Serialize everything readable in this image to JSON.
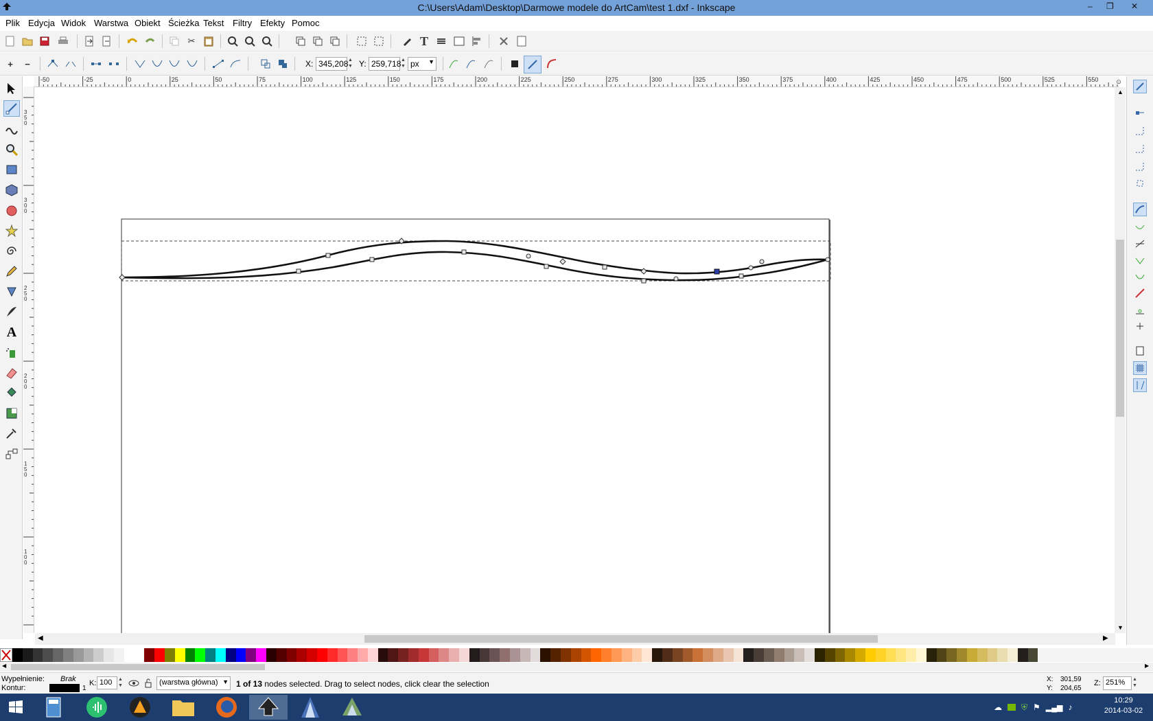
{
  "window": {
    "title": "C:\\Users\\Adam\\Desktop\\Darmowe modele do ArtCam\\test 1.dxf - Inkscape",
    "controls": [
      "–",
      "❐",
      "✕"
    ]
  },
  "menu": [
    "Plik",
    "Edycja",
    "Widok",
    "Warstwa",
    "Obiekt",
    "Ścieżka",
    "Tekst",
    "Filtry",
    "Efekty",
    "Pomoc"
  ],
  "node_toolbar": {
    "x_label": "X:",
    "x_value": "345,208",
    "y_label": "Y:",
    "y_value": "259,718",
    "unit": "px"
  },
  "rulers": {
    "horizontal_labels": [
      "-50",
      "-25",
      "0",
      "25",
      "50",
      "75",
      "100",
      "125",
      "150",
      "175",
      "200",
      "225",
      "250",
      "275",
      "300",
      "325",
      "350",
      "375",
      "400",
      "425",
      "450",
      "475",
      "500",
      "525",
      "550"
    ],
    "vertical_labels": [
      "3 5 0",
      "3 0 0",
      "2 5 0",
      "2 0 0",
      "1 5 0",
      "1 0 0"
    ],
    "corner_icon": "zoom-fit-icon"
  },
  "tools": [
    "selector-icon",
    "node-tool-icon",
    "tweak-icon",
    "zoom-icon",
    "rectangle-icon",
    "3d-box-icon",
    "ellipse-icon",
    "star-icon",
    "spiral-icon",
    "pencil-icon",
    "pen-icon",
    "calligraphy-icon",
    "text-icon",
    "spray-icon",
    "eraser-icon",
    "bucket-icon",
    "gradient-icon",
    "dropper-icon",
    "connector-icon"
  ],
  "active_tool": "node-tool-icon",
  "palette": {
    "colors": [
      "#000000",
      "#1a1a1a",
      "#333333",
      "#4d4d4d",
      "#666666",
      "#808080",
      "#999999",
      "#b3b3b3",
      "#cccccc",
      "#e6e6e6",
      "#f2f2f2",
      "#ffffff",
      "#ffffff",
      "#800000",
      "#ff0000",
      "#808000",
      "#ffff00",
      "#008000",
      "#00ff00",
      "#008080",
      "#00ffff",
      "#000080",
      "#0000ff",
      "#800080",
      "#ff00ff",
      "#2b0000",
      "#550000",
      "#800000",
      "#aa0000",
      "#d40000",
      "#ff0000",
      "#ff2a2a",
      "#ff5555",
      "#ff8080",
      "#ffaaaa",
      "#ffd5d5",
      "#280b0b",
      "#501616",
      "#782121",
      "#a02c2c",
      "#c83737",
      "#d35f5f",
      "#de8787",
      "#e9afaf",
      "#f4d7d7",
      "#241c1c",
      "#483737",
      "#6c5353",
      "#916f6f",
      "#ac9393",
      "#c8b7b7",
      "#e3dbdb",
      "#2b1100",
      "#552200",
      "#803300",
      "#aa4400",
      "#d45500",
      "#ff6600",
      "#ff7f2a",
      "#ff9955",
      "#ffb380",
      "#ffccaa",
      "#ffe6d5",
      "#28170b",
      "#502d16",
      "#784421",
      "#a05a2c",
      "#c87137",
      "#d38d5f",
      "#deaa87",
      "#e9c6af",
      "#f4e3d7",
      "#241f1c",
      "#483e37",
      "#6c5d53",
      "#917c6f",
      "#ac9d93",
      "#c8beb7",
      "#e3dedb",
      "#2b2200",
      "#554400",
      "#806600",
      "#aa8800",
      "#d4aa00",
      "#ffcc00",
      "#ffd42a",
      "#ffdd55",
      "#ffe680",
      "#ffeeaa",
      "#fff6d5",
      "#28220b",
      "#504416",
      "#786721",
      "#a0892c",
      "#c8ab37",
      "#d4bc5f",
      "#dfcb87",
      "#e9ddaf",
      "#f4eed7",
      "#241f1c",
      "#484837"
    ]
  },
  "status": {
    "fill_label": "Wypełnienie:",
    "fill_value": "Brak",
    "stroke_label": "Kontur:",
    "stroke_width": "1",
    "opacity_label": "K:",
    "opacity_value": "100",
    "layer": "(warstwa główna)",
    "message_bold": "1 of 13",
    "message_rest": " nodes selected. Drag to select nodes, click clear the selection",
    "cursor_x_label": "X:",
    "cursor_x": "301,59",
    "cursor_y_label": "Y:",
    "cursor_y": "204,65",
    "zoom_label": "Z:",
    "zoom_value": "251%"
  },
  "taskbar": {
    "apps": [
      "start-icon",
      "calculator-icon",
      "audio-app-icon",
      "vlc-icon",
      "file-explorer-icon",
      "firefox-icon",
      "inkscape-icon",
      "artcam-icon",
      "ds-app-icon"
    ],
    "active_app": "inkscape-icon",
    "time": "10:29",
    "date": "2014-03-02"
  }
}
